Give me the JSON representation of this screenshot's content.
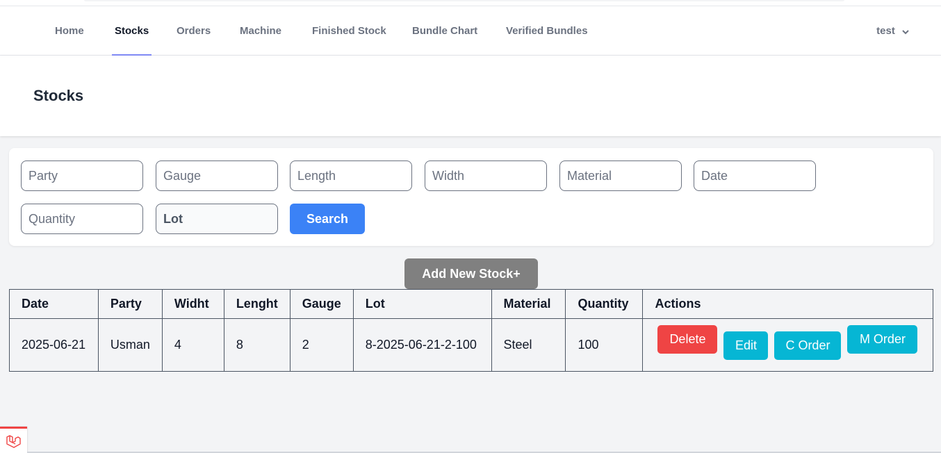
{
  "nav": {
    "items": [
      {
        "label": "Home",
        "active": false
      },
      {
        "label": "Stocks",
        "active": true
      },
      {
        "label": "Orders",
        "active": false
      },
      {
        "label": "Machine",
        "active": false
      },
      {
        "label": "Finished Stock",
        "active": false
      },
      {
        "label": "Bundle Chart",
        "active": false
      },
      {
        "label": "Verified Bundles",
        "active": false
      }
    ],
    "user": "test",
    "accent": "#818cf8"
  },
  "page": {
    "title": "Stocks"
  },
  "filters": {
    "party": "Party",
    "gauge": "Gauge",
    "length": "Length",
    "width": "Width",
    "material": "Material",
    "date": "Date",
    "quantity": "Quantity",
    "lot": "Lot",
    "search_label": "Search"
  },
  "add_button": "Add New Stock+",
  "table": {
    "headers": [
      "Date",
      "Party",
      "Widht",
      "Lenght",
      "Gauge",
      "Lot",
      "Material",
      "Quantity",
      "Actions"
    ],
    "rows": [
      {
        "cells": [
          "2025-06-21",
          "Usman",
          "4",
          "8",
          "2",
          "8-2025-06-21-2-100",
          "Steel",
          "100"
        ]
      }
    ],
    "actions": {
      "delete": "Delete",
      "edit": "Edit",
      "c_order": "C Order",
      "m_order": "M Order"
    }
  },
  "colors": {
    "primary": "#3b82f6",
    "danger": "#ef4444",
    "info": "#06b6d4",
    "neutral": "#808080"
  },
  "icons": {
    "user_menu": "chevron-down-icon",
    "debug_badge": "laravel-logo-icon"
  }
}
